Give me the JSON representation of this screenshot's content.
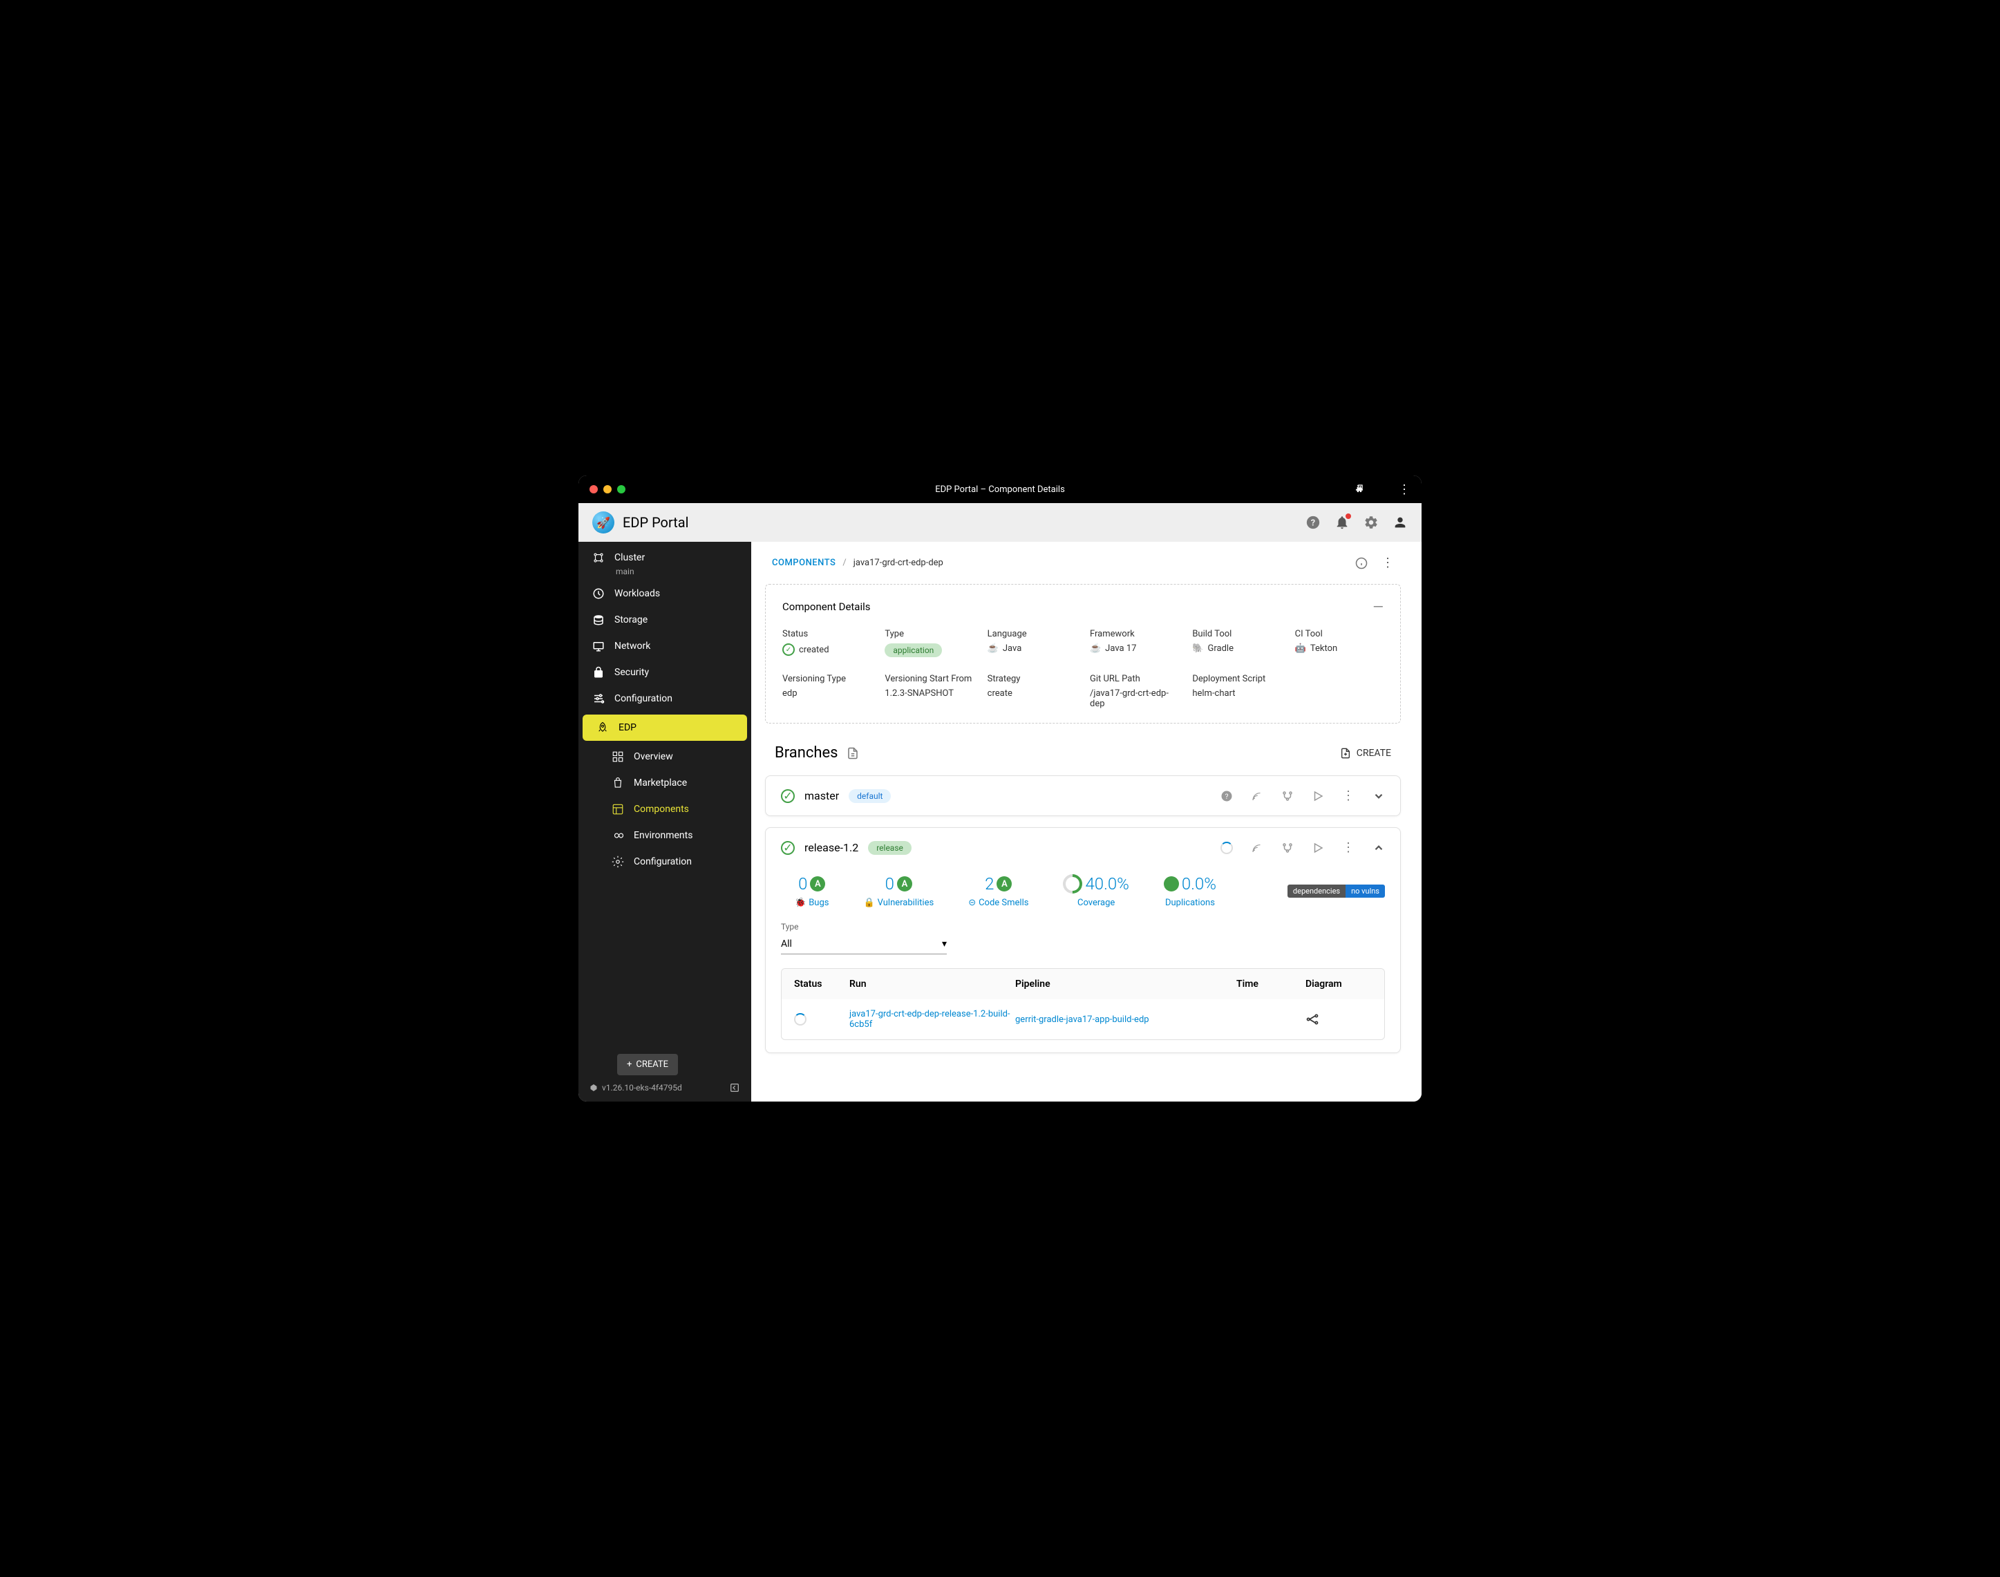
{
  "window": {
    "title": "EDP Portal – Component Details"
  },
  "app": {
    "name": "EDP Portal"
  },
  "sidebar": {
    "cluster": {
      "label": "Cluster",
      "context": "main"
    },
    "items": [
      {
        "label": "Workloads"
      },
      {
        "label": "Storage"
      },
      {
        "label": "Network"
      },
      {
        "label": "Security"
      },
      {
        "label": "Configuration"
      },
      {
        "label": "EDP"
      }
    ],
    "sub": [
      {
        "label": "Overview"
      },
      {
        "label": "Marketplace"
      },
      {
        "label": "Components"
      },
      {
        "label": "Environments"
      },
      {
        "label": "Configuration"
      }
    ],
    "create": "CREATE",
    "version": "v1.26.10-eks-4f4795d"
  },
  "breadcrumb": {
    "root": "COMPONENTS",
    "current": "java17-grd-crt-edp-dep"
  },
  "detailsCard": {
    "title": "Component Details",
    "rows": [
      {
        "label": "Status",
        "value": "created"
      },
      {
        "label": "Type",
        "value": "application"
      },
      {
        "label": "Language",
        "value": "Java"
      },
      {
        "label": "Framework",
        "value": "Java 17"
      },
      {
        "label": "Build Tool",
        "value": "Gradle"
      },
      {
        "label": "CI Tool",
        "value": "Tekton"
      },
      {
        "label": "Versioning Type",
        "value": "edp"
      },
      {
        "label": "Versioning Start From",
        "value": "1.2.3-SNAPSHOT"
      },
      {
        "label": "Strategy",
        "value": "create"
      },
      {
        "label": "Git URL Path",
        "value": "/java17-grd-crt-edp-dep"
      },
      {
        "label": "Deployment Script",
        "value": "helm-chart"
      }
    ]
  },
  "branches": {
    "title": "Branches",
    "create": "CREATE",
    "list": [
      {
        "name": "master",
        "tag": "default"
      },
      {
        "name": "release-1.2",
        "tag": "release"
      }
    ]
  },
  "metrics": {
    "bugs": {
      "value": "0",
      "grade": "A",
      "label": "Bugs"
    },
    "vulns": {
      "value": "0",
      "grade": "A",
      "label": "Vulnerabilities"
    },
    "smells": {
      "value": "2",
      "grade": "A",
      "label": "Code Smells"
    },
    "coverage": {
      "value": "40.0%",
      "label": "Coverage"
    },
    "dup": {
      "value": "0.0%",
      "label": "Duplications"
    },
    "badges": {
      "dep": "dependencies",
      "vuln": "no vulns"
    }
  },
  "filter": {
    "label": "Type",
    "value": "All"
  },
  "runs": {
    "headers": [
      "Status",
      "Run",
      "Pipeline",
      "Time",
      "Diagram"
    ],
    "row": {
      "run": "java17-grd-crt-edp-dep-release-1.2-build-6cb5f",
      "pipeline": "gerrit-gradle-java17-app-build-edp"
    }
  }
}
